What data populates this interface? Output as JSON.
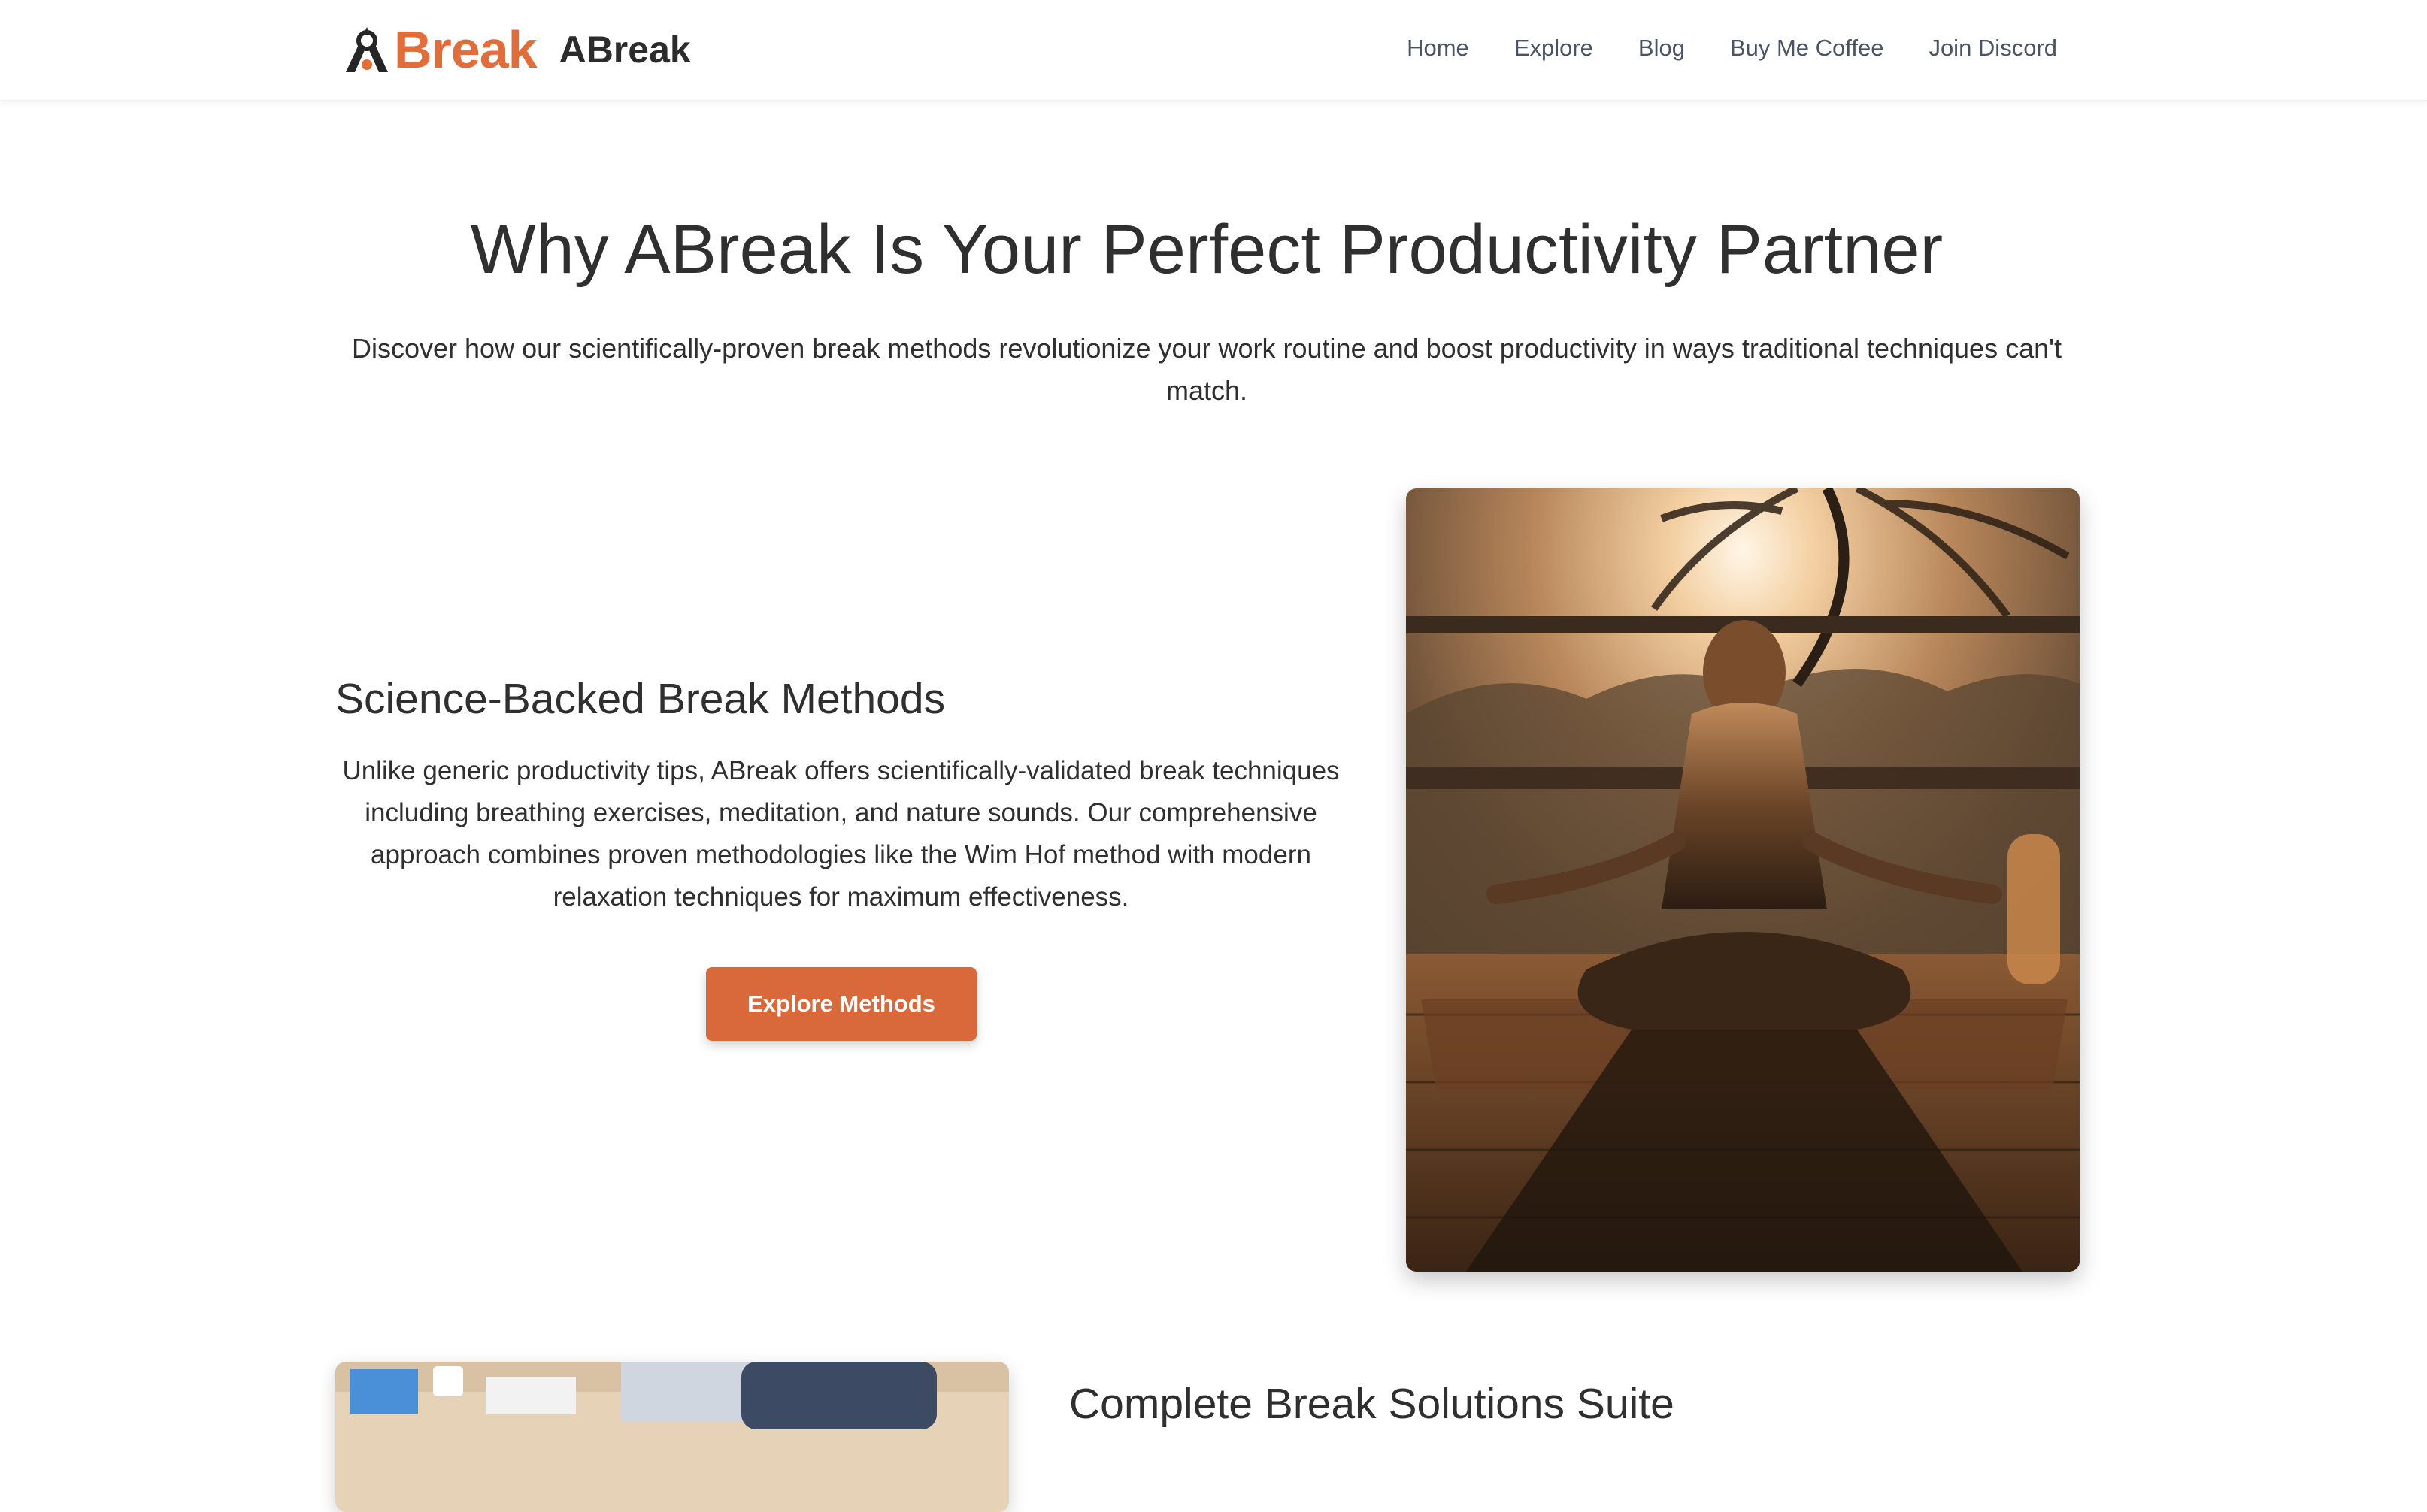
{
  "header": {
    "logo_text": "Break",
    "brand_name": "ABreak",
    "nav": [
      {
        "label": "Home"
      },
      {
        "label": "Explore"
      },
      {
        "label": "Blog"
      },
      {
        "label": "Buy Me Coffee"
      },
      {
        "label": "Join Discord"
      }
    ]
  },
  "hero": {
    "title": "Why ABreak Is Your Perfect Productivity Partner",
    "subtitle": "Discover how our scientifically-proven break methods revolutionize your work routine and boost productivity in ways traditional techniques can't match."
  },
  "features": [
    {
      "title": "Science-Backed Break Methods",
      "text": "Unlike generic productivity tips, ABreak offers scientifically-validated break techniques including breathing exercises, meditation, and nature sounds. Our comprehensive approach combines proven methodologies like the Wim Hof method with modern relaxation techniques for maximum effectiveness.",
      "button_label": "Explore Methods"
    },
    {
      "title": "Complete Break Solutions Suite"
    }
  ],
  "colors": {
    "accent": "#d9683a",
    "text": "#2f2f2f",
    "nav_text": "#4a5363"
  }
}
